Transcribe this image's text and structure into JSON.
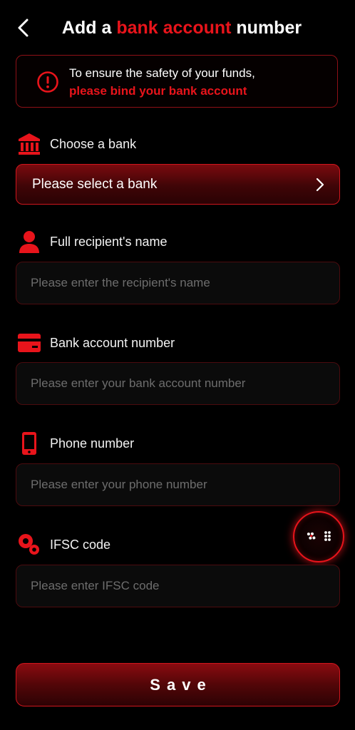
{
  "header": {
    "title_prefix": "Add a ",
    "title_accent": "bank account",
    "title_suffix": " number"
  },
  "notice": {
    "line1": "To ensure the safety of your funds,",
    "line2": "please bind your bank account"
  },
  "bank": {
    "label": "Choose a bank",
    "select_text": "Please select a bank"
  },
  "name": {
    "label": "Full recipient's name",
    "placeholder": "Please enter the recipient's name",
    "value": ""
  },
  "account": {
    "label": "Bank account number",
    "placeholder": "Please enter your bank account number",
    "value": ""
  },
  "phone": {
    "label": "Phone number",
    "placeholder": "Please enter your phone number",
    "value": ""
  },
  "ifsc": {
    "label": "IFSC code",
    "placeholder": "Please enter IFSC code",
    "value": ""
  },
  "save_label": "Save",
  "colors": {
    "accent": "#e8141b",
    "background": "#000000",
    "placeholder": "#6d6d6d"
  },
  "icons": {
    "back": "chevron-left-icon",
    "alert": "alert-circle-icon",
    "bank": "bank-icon",
    "person": "person-icon",
    "card": "card-icon",
    "phone": "phone-icon",
    "ifsc": "gear-icon",
    "select": "chevron-right-icon",
    "float": "dice-icon"
  }
}
